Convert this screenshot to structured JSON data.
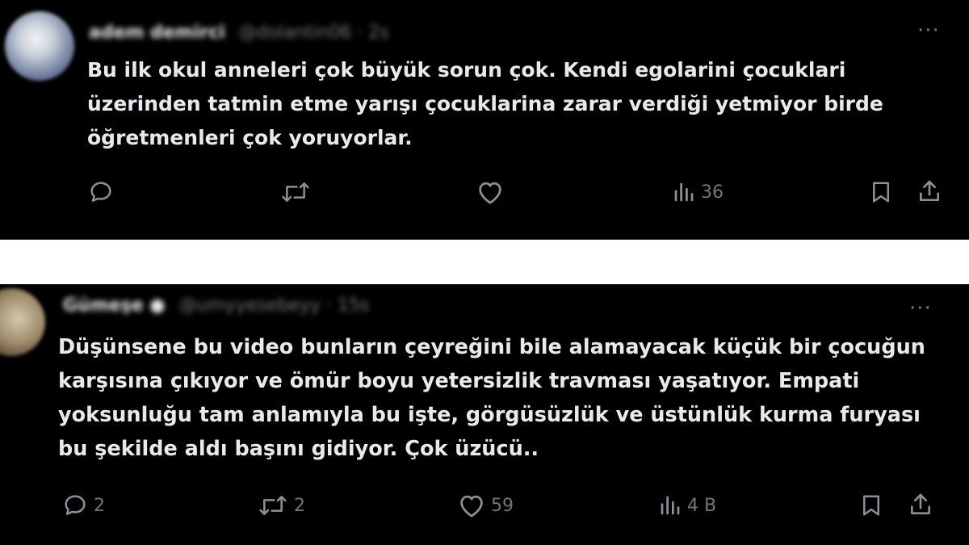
{
  "tweet1": {
    "author_name": "adem demirci",
    "author_handle": "@dolantin06",
    "time": "· 2s",
    "text": "Bu ilk okul anneleri çok büyük sorun çok. Kendi egolarini çocuklari\nüzerinden tatmin etme yarışı çocuklarina zarar verdiği yetmiyor birde\nöğretmenleri çok yoruyorlar.",
    "more": "···",
    "actions": {
      "reply_count": "",
      "repost_count": "",
      "like_count": "",
      "views_count": "36"
    }
  },
  "tweet2": {
    "author_name": "Gümeşe ●",
    "author_handle": "@umyyesebeyy",
    "time": "· 15s",
    "text": "Düşünsene bu video bunların çeyreğini bile alamayacak küçük bir çocuğun\nkarşısına çıkıyor ve ömür boyu yetersizlik travması yaşatıyor. Empati\nyoksunluğu tam anlamıyla bu işte, görgüsüzlük ve üstünlük kurma furyası\nbu şekilde aldı başını gidiyor. Çok üzücü..",
    "more": "···",
    "actions": {
      "reply_count": "2",
      "repost_count": "2",
      "like_count": "59",
      "views_count": "4 B"
    }
  },
  "icons": {
    "reply": "reply-icon",
    "repost": "repost-icon",
    "like": "like-icon",
    "views": "views-icon",
    "bookmark": "bookmark-icon",
    "share": "share-icon"
  },
  "colors": {
    "background": "#000000",
    "text": "#e7e9ea",
    "muted": "#71767b"
  }
}
